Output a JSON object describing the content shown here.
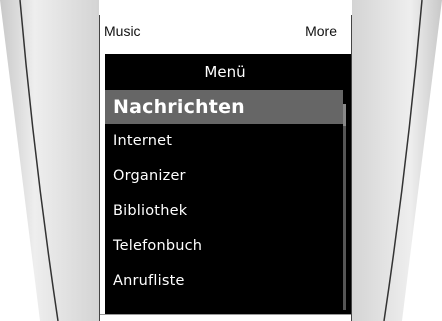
{
  "softkeys": {
    "left": "Music",
    "right": "More"
  },
  "menu": {
    "title": "Menü",
    "items": [
      {
        "label": "Nachrichten",
        "selected": true
      },
      {
        "label": "Internet"
      },
      {
        "label": "Organizer"
      },
      {
        "label": "Bibliothek"
      },
      {
        "label": "Telefonbuch"
      },
      {
        "label": "Anrufliste"
      }
    ]
  },
  "colors": {
    "screen_bg": "#000000",
    "highlight": "#666666",
    "bezel_light": "#e6e6e6",
    "bezel_dark": "#bdbdbd"
  }
}
